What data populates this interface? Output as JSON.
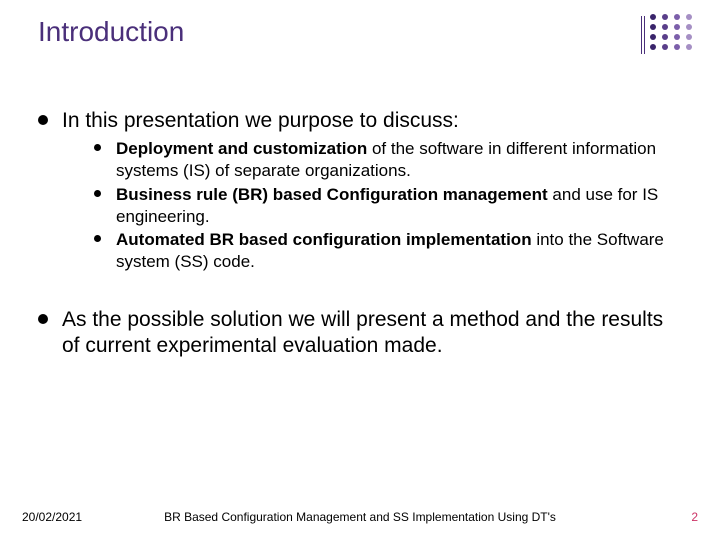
{
  "title": "Introduction",
  "topLevel": {
    "intro": "In this presentation we purpose to discuss:",
    "closing": "As the possible solution we will present a method and the results of current experimental evaluation made."
  },
  "subItems": [
    {
      "bold": "Deployment and customization",
      "rest": " of the software in different information systems (IS) of separate organizations."
    },
    {
      "bold": "Business rule (BR) based Configuration management",
      "rest": " and use for IS engineering."
    },
    {
      "bold": "Automated BR based configuration implementation",
      "rest": " into the Software system (SS) code."
    }
  ],
  "footer": {
    "date": "20/02/2021",
    "center": "BR Based Configuration Management and SS Implementation Using DT's",
    "page": "2"
  },
  "colors": {
    "titleColor": "#4a2f7a",
    "pageNumberColor": "#cc3366"
  }
}
